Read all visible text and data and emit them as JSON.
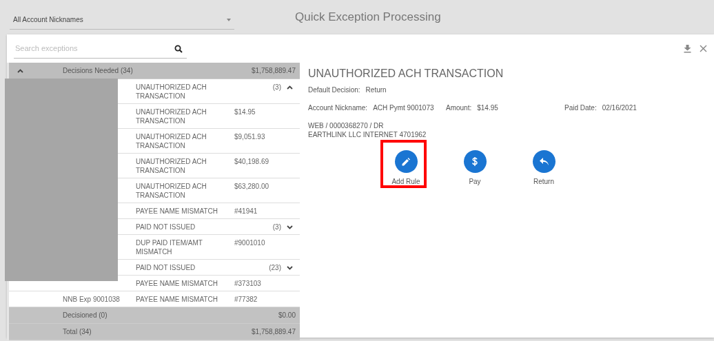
{
  "filter": {
    "value": "All Account Nicknames"
  },
  "title": "Quick Exception Processing",
  "search": {
    "placeholder": "Search exceptions"
  },
  "list": {
    "header": {
      "label": "Decisions Needed (34)",
      "amount": "$1,758,889.47",
      "expanded": true
    },
    "rows": [
      {
        "kind": "group",
        "type": "UNAUTHORIZED ACH TRANSACTION",
        "count": "(3)",
        "expanded": true
      },
      {
        "kind": "item",
        "type": "UNAUTHORIZED ACH TRANSACTION",
        "amount": "$14.95"
      },
      {
        "kind": "item",
        "type": "UNAUTHORIZED ACH TRANSACTION",
        "amount": "$9,051.93"
      },
      {
        "kind": "item",
        "type": "UNAUTHORIZED ACH TRANSACTION",
        "amount": "$40,198.69"
      },
      {
        "kind": "item",
        "type": "UNAUTHORIZED ACH TRANSACTION",
        "amount": "$63,280.00"
      },
      {
        "kind": "item",
        "type": "PAYEE NAME MISMATCH",
        "amount": "#41941"
      },
      {
        "kind": "group",
        "type": "PAID NOT ISSUED",
        "count": "(3)",
        "expanded": false
      },
      {
        "kind": "item",
        "type": "DUP PAID ITEM/AMT MISMATCH",
        "amount": "#9001010"
      },
      {
        "kind": "group",
        "type": "PAID NOT ISSUED",
        "count": "(23)",
        "expanded": false
      },
      {
        "kind": "item",
        "type": "PAYEE NAME MISMATCH",
        "amount": "#373103"
      },
      {
        "kind": "item",
        "account": "NNB Exp 9001038",
        "type": "PAYEE NAME MISMATCH",
        "amount": "#77382"
      }
    ],
    "footers": [
      {
        "label": "Decisioned (0)",
        "amount": "$0.00"
      },
      {
        "label": "Total (34)",
        "amount": "$1,758,889.47"
      }
    ]
  },
  "detail": {
    "title": "UNAUTHORIZED ACH TRANSACTION",
    "default_decision": {
      "label": "Default Decision:",
      "value": "Return"
    },
    "fields": [
      {
        "label": "Account Nickname:",
        "value": "ACH Pymt 9001073"
      },
      {
        "label": "Amount:",
        "value": "$14.95"
      },
      {
        "label": "Paid Date:",
        "value": "02/16/2021"
      }
    ],
    "description": [
      "WEB / 0000368270 / DR",
      "EARTHLINK LLC INTERNET 4701962"
    ],
    "actions": [
      {
        "kind": "edit",
        "label": "Add Rule",
        "highlighted": true
      },
      {
        "kind": "pay",
        "label": "Pay",
        "highlighted": false
      },
      {
        "kind": "return",
        "label": "Return",
        "highlighted": false
      }
    ]
  }
}
